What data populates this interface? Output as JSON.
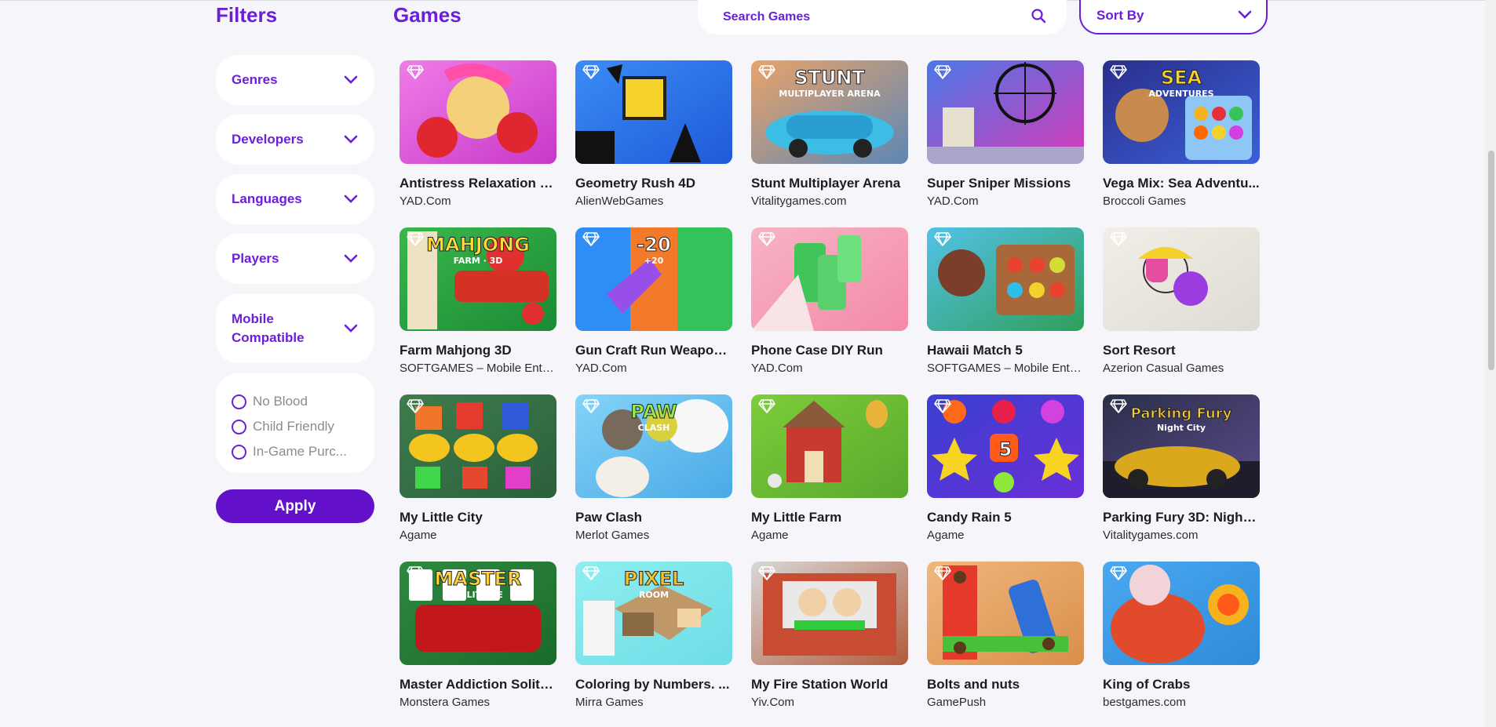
{
  "sidebar": {
    "title": "Filters",
    "filters": [
      {
        "label": "Genres"
      },
      {
        "label": "Developers"
      },
      {
        "label": "Languages"
      },
      {
        "label": "Players"
      },
      {
        "label": "Mobile Compatible"
      }
    ],
    "checks": [
      {
        "label": "No Blood"
      },
      {
        "label": "Child Friendly"
      },
      {
        "label": "In-Game Purc..."
      }
    ],
    "apply_label": "Apply"
  },
  "header": {
    "title": "Games",
    "search_placeholder": "Search Games",
    "sort_label": "Sort By"
  },
  "games": [
    {
      "title": "Antistress Relaxation Box",
      "developer": "YAD.Com",
      "art": "pink"
    },
    {
      "title": "Geometry Rush 4D",
      "developer": "AlienWebGames",
      "art": "blue"
    },
    {
      "title": "Stunt Multiplayer Arena",
      "developer": "Vitalitygames.com",
      "art": "car",
      "logo": "STUNT",
      "logo_sub": "MULTIPLAYER ARENA"
    },
    {
      "title": "Super Sniper Missions",
      "developer": "YAD.Com",
      "art": "sniper"
    },
    {
      "title": "Vega Mix: Sea Adventu...",
      "developer": "Broccoli Games",
      "art": "sea",
      "logo": "SEA",
      "logo_sub": "ADVENTURES"
    },
    {
      "title": "Farm Mahjong 3D",
      "developer": "SOFTGAMES – Mobile Enter...",
      "art": "farmmj",
      "logo": "MAHJONG",
      "logo_sub": "FARM · 3D"
    },
    {
      "title": "Gun Craft Run Weapon ...",
      "developer": "YAD.Com",
      "art": "gun",
      "logo": "-20",
      "logo_sub": "+20"
    },
    {
      "title": "Phone Case DIY Run",
      "developer": "YAD.Com",
      "art": "phone"
    },
    {
      "title": "Hawaii Match 5",
      "developer": "SOFTGAMES – Mobile Enter...",
      "art": "hawaii"
    },
    {
      "title": "Sort Resort",
      "developer": "Azerion Casual Games",
      "art": "sort"
    },
    {
      "title": "My Little City",
      "developer": "Agame",
      "art": "city"
    },
    {
      "title": "Paw Clash",
      "developer": "Merlot Games",
      "art": "paw",
      "logo": "PAW",
      "logo_sub": "CLASH"
    },
    {
      "title": "My Little Farm",
      "developer": "Agame",
      "art": "farm"
    },
    {
      "title": "Candy Rain 5",
      "developer": "Agame",
      "art": "candy",
      "logo": "5"
    },
    {
      "title": "Parking Fury 3D: Night ...",
      "developer": "Vitalitygames.com",
      "art": "parking",
      "logo": "Parking Fury",
      "logo_sub": "Night City"
    },
    {
      "title": "Master Addiction Solita...",
      "developer": "Monstera Games",
      "art": "solitaire",
      "logo": "MASTER",
      "logo_sub": "SOLITAIRE"
    },
    {
      "title": "Coloring by Numbers. ...",
      "developer": "Mirra Games",
      "art": "coloring",
      "logo": "PIXEL",
      "logo_sub": "ROOM"
    },
    {
      "title": "My Fire Station World",
      "developer": "Yiv.Com",
      "art": "fire"
    },
    {
      "title": "Bolts and nuts",
      "developer": "GamePush",
      "art": "bolts"
    },
    {
      "title": "King of Crabs",
      "developer": "bestgames.com",
      "art": "crabs"
    }
  ]
}
